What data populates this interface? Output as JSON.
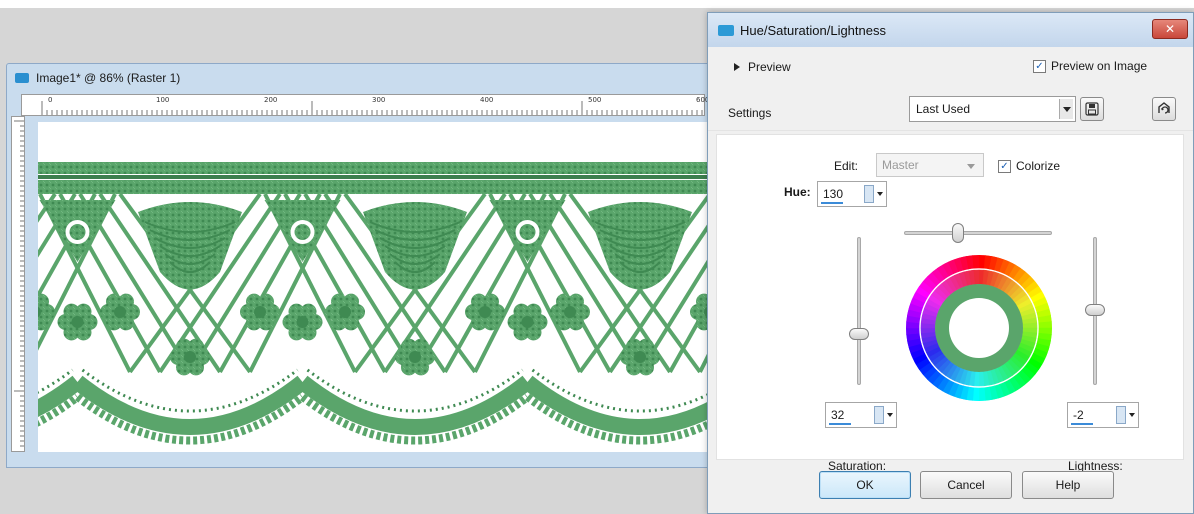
{
  "image_window": {
    "title": "Image1* @  86% (Raster 1)",
    "ruler_labels": [
      "0",
      "100",
      "200",
      "300",
      "400",
      "500",
      "600"
    ],
    "lace_color": "#5aa56b"
  },
  "dialog": {
    "title": "Hue/Saturation/Lightness",
    "close_label": "✕",
    "preview_label": "Preview",
    "preview_on_image_label": "Preview on Image",
    "preview_on_image_checked": true,
    "settings_label": "Settings",
    "settings_value": "Last Used",
    "edit_label": "Edit:",
    "edit_value": "Master",
    "colorize_label": "Colorize",
    "colorize_checked": true,
    "hue_label": "Hue:",
    "hue_value": "130",
    "saturation_value": "32",
    "saturation_label": "Saturation:",
    "lightness_value": "-2",
    "lightness_label": "Lightness:",
    "buttons": {
      "ok": "OK",
      "cancel": "Cancel",
      "help": "Help"
    },
    "accent_color": "#3b8bd8",
    "colorized_color": "#5aa56b"
  }
}
